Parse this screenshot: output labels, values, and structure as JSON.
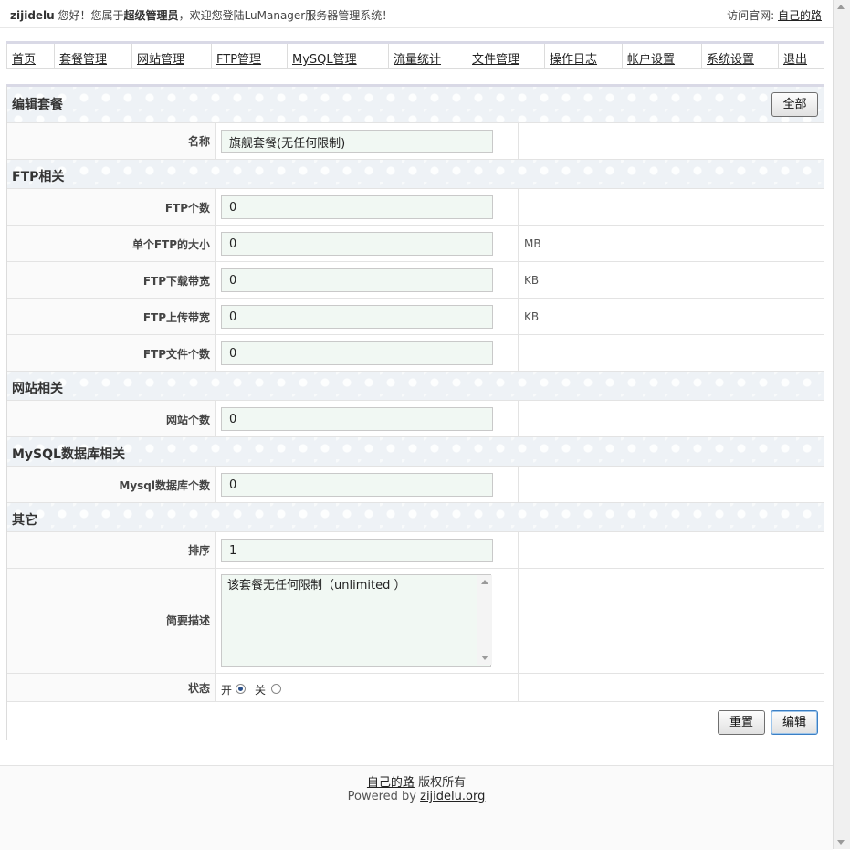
{
  "topbar": {
    "user": "zijidelu",
    "greeting_pre": " 您好！您属于",
    "role": "超级管理员",
    "greeting_post": "，欢迎您登陆LuManager服务器管理系统！",
    "visit_label": "访问官网: ",
    "visit_link": "自己的路"
  },
  "nav": {
    "items": [
      {
        "label": "首页",
        "width": 52
      },
      {
        "label": "套餐管理",
        "width": 85
      },
      {
        "label": "网站管理",
        "width": 87
      },
      {
        "label": "FTP管理",
        "width": 83
      },
      {
        "label": "MySQL管理",
        "width": 111
      },
      {
        "label": "流量统计",
        "width": 86
      },
      {
        "label": "文件管理",
        "width": 85
      },
      {
        "label": "操作日志",
        "width": 85
      },
      {
        "label": "帐户设置",
        "width": 87
      },
      {
        "label": "系统设置",
        "width": 84
      },
      {
        "label": "退出",
        "width": 51
      }
    ]
  },
  "form": {
    "header_title": "编辑套餐",
    "all_button": "全部",
    "name": {
      "label": "名称",
      "value": "旗舰套餐(无任何限制)"
    },
    "ftp_section": "FTP相关",
    "ftp_count": {
      "label": "FTP个数",
      "value": "0"
    },
    "ftp_size": {
      "label": "单个FTP的大小",
      "value": "0",
      "unit": "MB"
    },
    "ftp_download": {
      "label": "FTP下载带宽",
      "value": "0",
      "unit": "KB"
    },
    "ftp_upload": {
      "label": "FTP上传带宽",
      "value": "0",
      "unit": "KB"
    },
    "ftp_files": {
      "label": "FTP文件个数",
      "value": "0"
    },
    "site_section": "网站相关",
    "site_count": {
      "label": "网站个数",
      "value": "0"
    },
    "mysql_section": "MySQL数据库相关",
    "mysql_count": {
      "label": "Mysql数据库个数",
      "value": "0"
    },
    "other_section": "其它",
    "sort": {
      "label": "排序",
      "value": "1"
    },
    "desc": {
      "label": "简要描述",
      "value": "该套餐无任何限制（unlimited ）"
    },
    "status": {
      "label": "状态",
      "on": "开",
      "off": "关",
      "selected": "on"
    },
    "reset_button": "重置",
    "submit_button": "编辑"
  },
  "footer": {
    "link": "自己的路",
    "rights": " 版权所有",
    "powered_pre": "Powered by ",
    "powered_link": "zijidelu.org"
  }
}
